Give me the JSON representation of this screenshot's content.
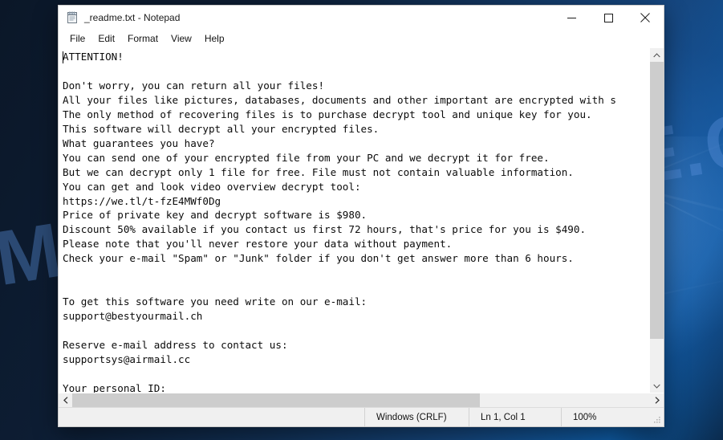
{
  "window": {
    "title": "_readme.txt - Notepad",
    "app_icon": "notepad-icon",
    "controls": {
      "minimize": "Minimize",
      "maximize": "Maximize",
      "close": "Close"
    }
  },
  "menubar": {
    "items": [
      {
        "label": "File"
      },
      {
        "label": "Edit"
      },
      {
        "label": "Format"
      },
      {
        "label": "View"
      },
      {
        "label": "Help"
      }
    ]
  },
  "document": {
    "filename": "_readme.txt",
    "lines": [
      "ATTENTION!",
      "",
      "Don't worry, you can return all your files!",
      "All your files like pictures, databases, documents and other important are encrypted with s",
      "The only method of recovering files is to purchase decrypt tool and unique key for you.",
      "This software will decrypt all your encrypted files.",
      "What guarantees you have?",
      "You can send one of your encrypted file from your PC and we decrypt it for free.",
      "But we can decrypt only 1 file for free. File must not contain valuable information.",
      "You can get and look video overview decrypt tool:",
      "https://we.tl/t-fzE4MWf0Dg",
      "Price of private key and decrypt software is $980.",
      "Discount 50% available if you contact us first 72 hours, that's price for you is $490.",
      "Please note that you'll never restore your data without payment.",
      "Check your e-mail \"Spam\" or \"Junk\" folder if you don't get answer more than 6 hours.",
      "",
      "",
      "To get this software you need write on our e-mail:",
      "support@bestyourmail.ch",
      "",
      "Reserve e-mail address to contact us:",
      "supportsys@airmail.cc",
      "",
      "Your personal ID:"
    ],
    "text": "ATTENTION!\n\nDon't worry, you can return all your files!\nAll your files like pictures, databases, documents and other important are encrypted with s\nThe only method of recovering files is to purchase decrypt tool and unique key for you.\nThis software will decrypt all your encrypted files.\nWhat guarantees you have?\nYou can send one of your encrypted file from your PC and we decrypt it for free.\nBut we can decrypt only 1 file for free. File must not contain valuable information.\nYou can get and look video overview decrypt tool:\nhttps://we.tl/t-fzE4MWf0Dg\nPrice of private key and decrypt software is $980.\nDiscount 50% available if you contact us first 72 hours, that's price for you is $490.\nPlease note that you'll never restore your data without payment.\nCheck your e-mail \"Spam\" or \"Junk\" folder if you don't get answer more than 6 hours.\n\n\nTo get this software you need write on our e-mail:\nsupport@bestyourmail.ch\n\nReserve e-mail address to contact us:\nsupportsys@airmail.cc\n\nYour personal ID:",
    "ransom_details": {
      "price_full": "$980",
      "price_discount": "$490",
      "discount_percent": "50%",
      "discount_window_hours": "72 hours",
      "response_time": "6 hours",
      "free_files": "1 file",
      "video_url": "https://we.tl/t-fzE4MWf0Dg",
      "email_primary": "support@bestyourmail.ch",
      "email_reserve": "supportsys@airmail.cc"
    }
  },
  "statusbar": {
    "line_ending": "Windows (CRLF)",
    "cursor_position": "Ln 1, Col 1",
    "zoom": "100%"
  },
  "scrollbars": {
    "vertical_up": "▲",
    "vertical_down": "▼",
    "horizontal_left": "◄",
    "horizontal_right": "►"
  },
  "watermark": {
    "text": "MYANTISPYWARE.COM",
    "color": "#5a91dc"
  },
  "theme": {
    "window_bg": "#ffffff",
    "chrome_bg": "#f0f0f0",
    "text_color": "#0b0b0b",
    "scroll_thumb": "#cdcdcd",
    "desktop_blue": "#15467d"
  }
}
